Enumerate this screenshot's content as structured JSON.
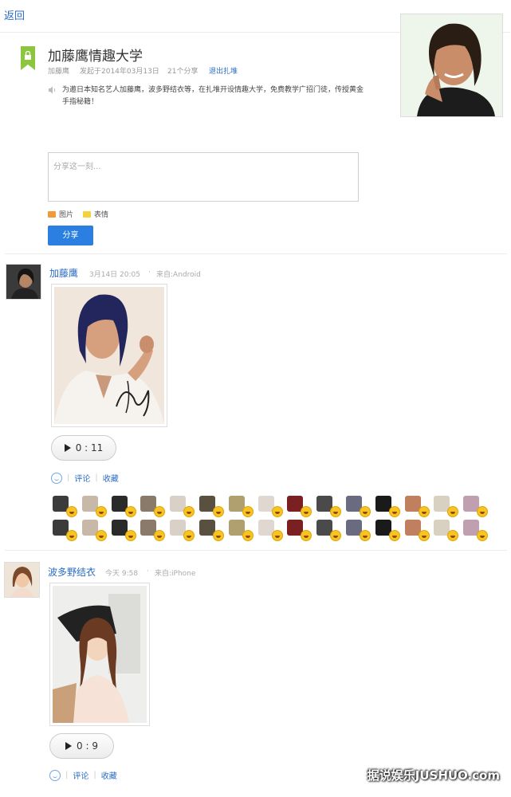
{
  "nav": {
    "back_label": "返回"
  },
  "group": {
    "title": "加藤鹰情趣大学",
    "owner": "加藤鹰",
    "founded": "发起于2014年03月13日",
    "share_count": "21个分享",
    "quit_label": "退出扎堆",
    "description": "为邀日本知名艺人加藤鹰，波多野结衣等，在扎堆开设情趣大学，免费教学广招门徒，传授黄金手指秘籍！"
  },
  "composer": {
    "placeholder": "分享这一刻...",
    "image_label": "图片",
    "emoji_label": "表情",
    "share_button": "分享"
  },
  "posts": [
    {
      "author": "加藤鹰",
      "time": "3月14日 20:05",
      "dot": "·",
      "source": "来自:Android",
      "audio_duration": "0 : 11",
      "comment_label": "评论",
      "favorite_label": "收藏"
    },
    {
      "author": "波多野结衣",
      "time": "今天 9:58",
      "dot": "·",
      "source": "来自:iPhone",
      "audio_duration": "0 : 9",
      "comment_label": "评论",
      "favorite_label": "收藏"
    }
  ],
  "likers_count": 30,
  "colors": {
    "accent": "#2b6cc4",
    "button": "#2a7fe0",
    "group_badge": "#8cc63f"
  },
  "watermark": "据说娱乐JUSHUO.com"
}
